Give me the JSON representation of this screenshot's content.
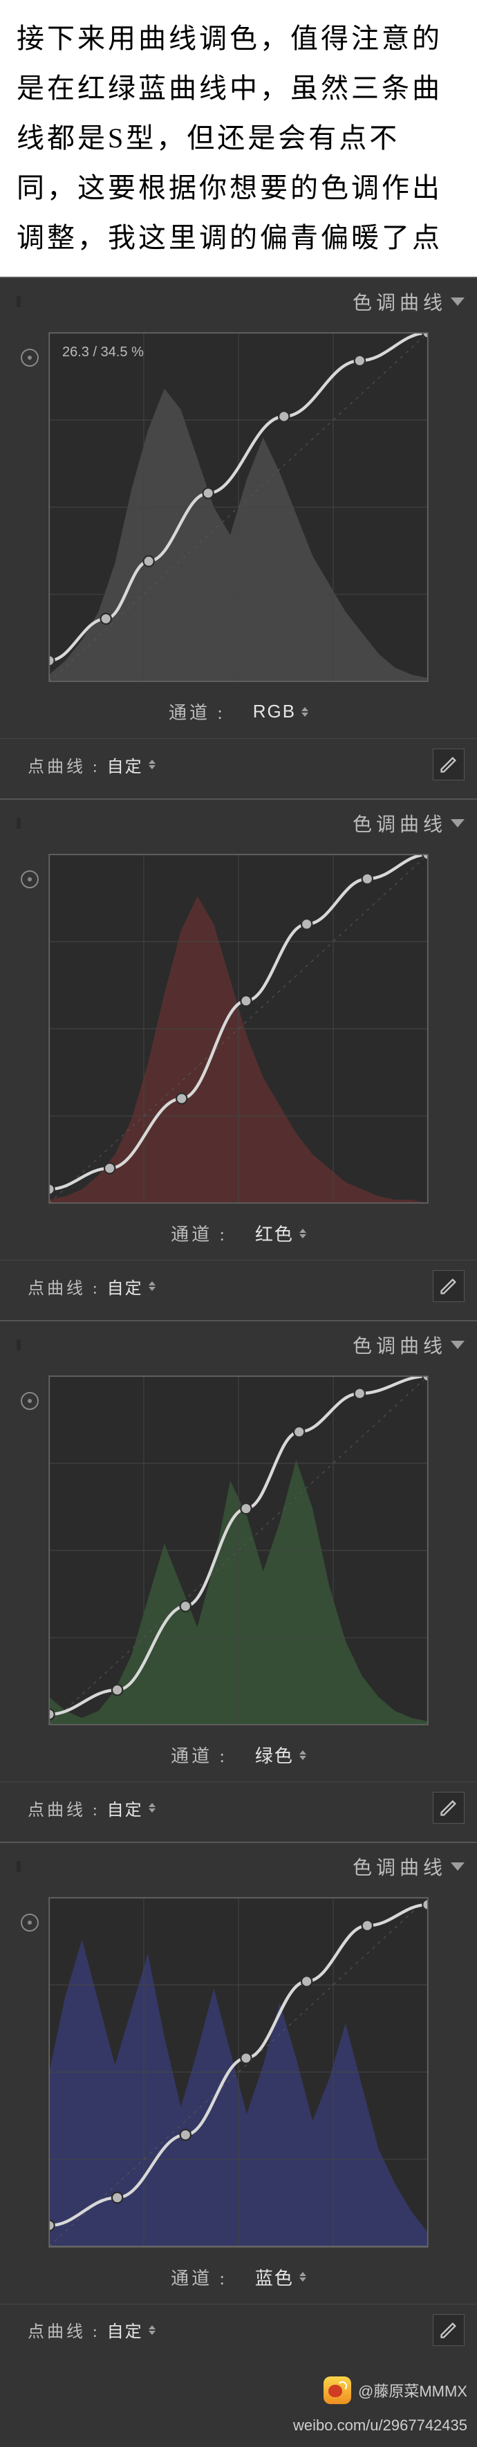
{
  "intro_text": "接下来用曲线调色，值得注意的是在红绿蓝曲线中，虽然三条曲线都是S型，但还是会有点不同，这要根据你想要的色调作出调整，我这里调的偏青偏暖了点",
  "panel_title": "色调曲线",
  "channel_label": "通道 :",
  "footer_label": "点曲线 :",
  "footer_value": "自定",
  "panels": [
    {
      "channel": "RGB",
      "coord": "26.3 / 34.5 %",
      "hist_fill": "#4a4a4a"
    },
    {
      "channel": "红色",
      "coord": "",
      "hist_fill": "#5a3030"
    },
    {
      "channel": "绿色",
      "coord": "",
      "hist_fill": "#365236"
    },
    {
      "channel": "蓝色",
      "coord": "",
      "hist_fill": "#363a6a"
    }
  ],
  "chart_data": [
    {
      "type": "line",
      "title": "色调曲线 RGB",
      "xlabel": "",
      "ylabel": "",
      "xlim": [
        0,
        100
      ],
      "ylim": [
        0,
        100
      ],
      "histogram_channel": "rgb",
      "points": [
        {
          "x": 0,
          "y": 6
        },
        {
          "x": 15,
          "y": 18
        },
        {
          "x": 26.3,
          "y": 34.5
        },
        {
          "x": 42,
          "y": 54
        },
        {
          "x": 62,
          "y": 76
        },
        {
          "x": 82,
          "y": 92
        },
        {
          "x": 100,
          "y": 100
        }
      ]
    },
    {
      "type": "line",
      "title": "色调曲线 红色",
      "xlabel": "",
      "ylabel": "",
      "xlim": [
        0,
        100
      ],
      "ylim": [
        0,
        100
      ],
      "histogram_channel": "red",
      "points": [
        {
          "x": 0,
          "y": 4
        },
        {
          "x": 16,
          "y": 10
        },
        {
          "x": 35,
          "y": 30
        },
        {
          "x": 52,
          "y": 58
        },
        {
          "x": 68,
          "y": 80
        },
        {
          "x": 84,
          "y": 93
        },
        {
          "x": 100,
          "y": 100
        }
      ]
    },
    {
      "type": "line",
      "title": "色调曲线 绿色",
      "xlabel": "",
      "ylabel": "",
      "xlim": [
        0,
        100
      ],
      "ylim": [
        0,
        100
      ],
      "histogram_channel": "green",
      "points": [
        {
          "x": 0,
          "y": 3
        },
        {
          "x": 18,
          "y": 10
        },
        {
          "x": 36,
          "y": 34
        },
        {
          "x": 52,
          "y": 62
        },
        {
          "x": 66,
          "y": 84
        },
        {
          "x": 82,
          "y": 95
        },
        {
          "x": 100,
          "y": 100
        }
      ]
    },
    {
      "type": "line",
      "title": "色调曲线 蓝色",
      "xlabel": "",
      "ylabel": "",
      "xlim": [
        0,
        100
      ],
      "ylim": [
        0,
        100
      ],
      "histogram_channel": "blue",
      "points": [
        {
          "x": 0,
          "y": 6
        },
        {
          "x": 18,
          "y": 14
        },
        {
          "x": 36,
          "y": 32
        },
        {
          "x": 52,
          "y": 54
        },
        {
          "x": 68,
          "y": 76
        },
        {
          "x": 84,
          "y": 92
        },
        {
          "x": 100,
          "y": 98
        }
      ]
    }
  ],
  "attribution": {
    "name": "@藤原菜MMMX",
    "url": "weibo.com/u/2967742435"
  }
}
